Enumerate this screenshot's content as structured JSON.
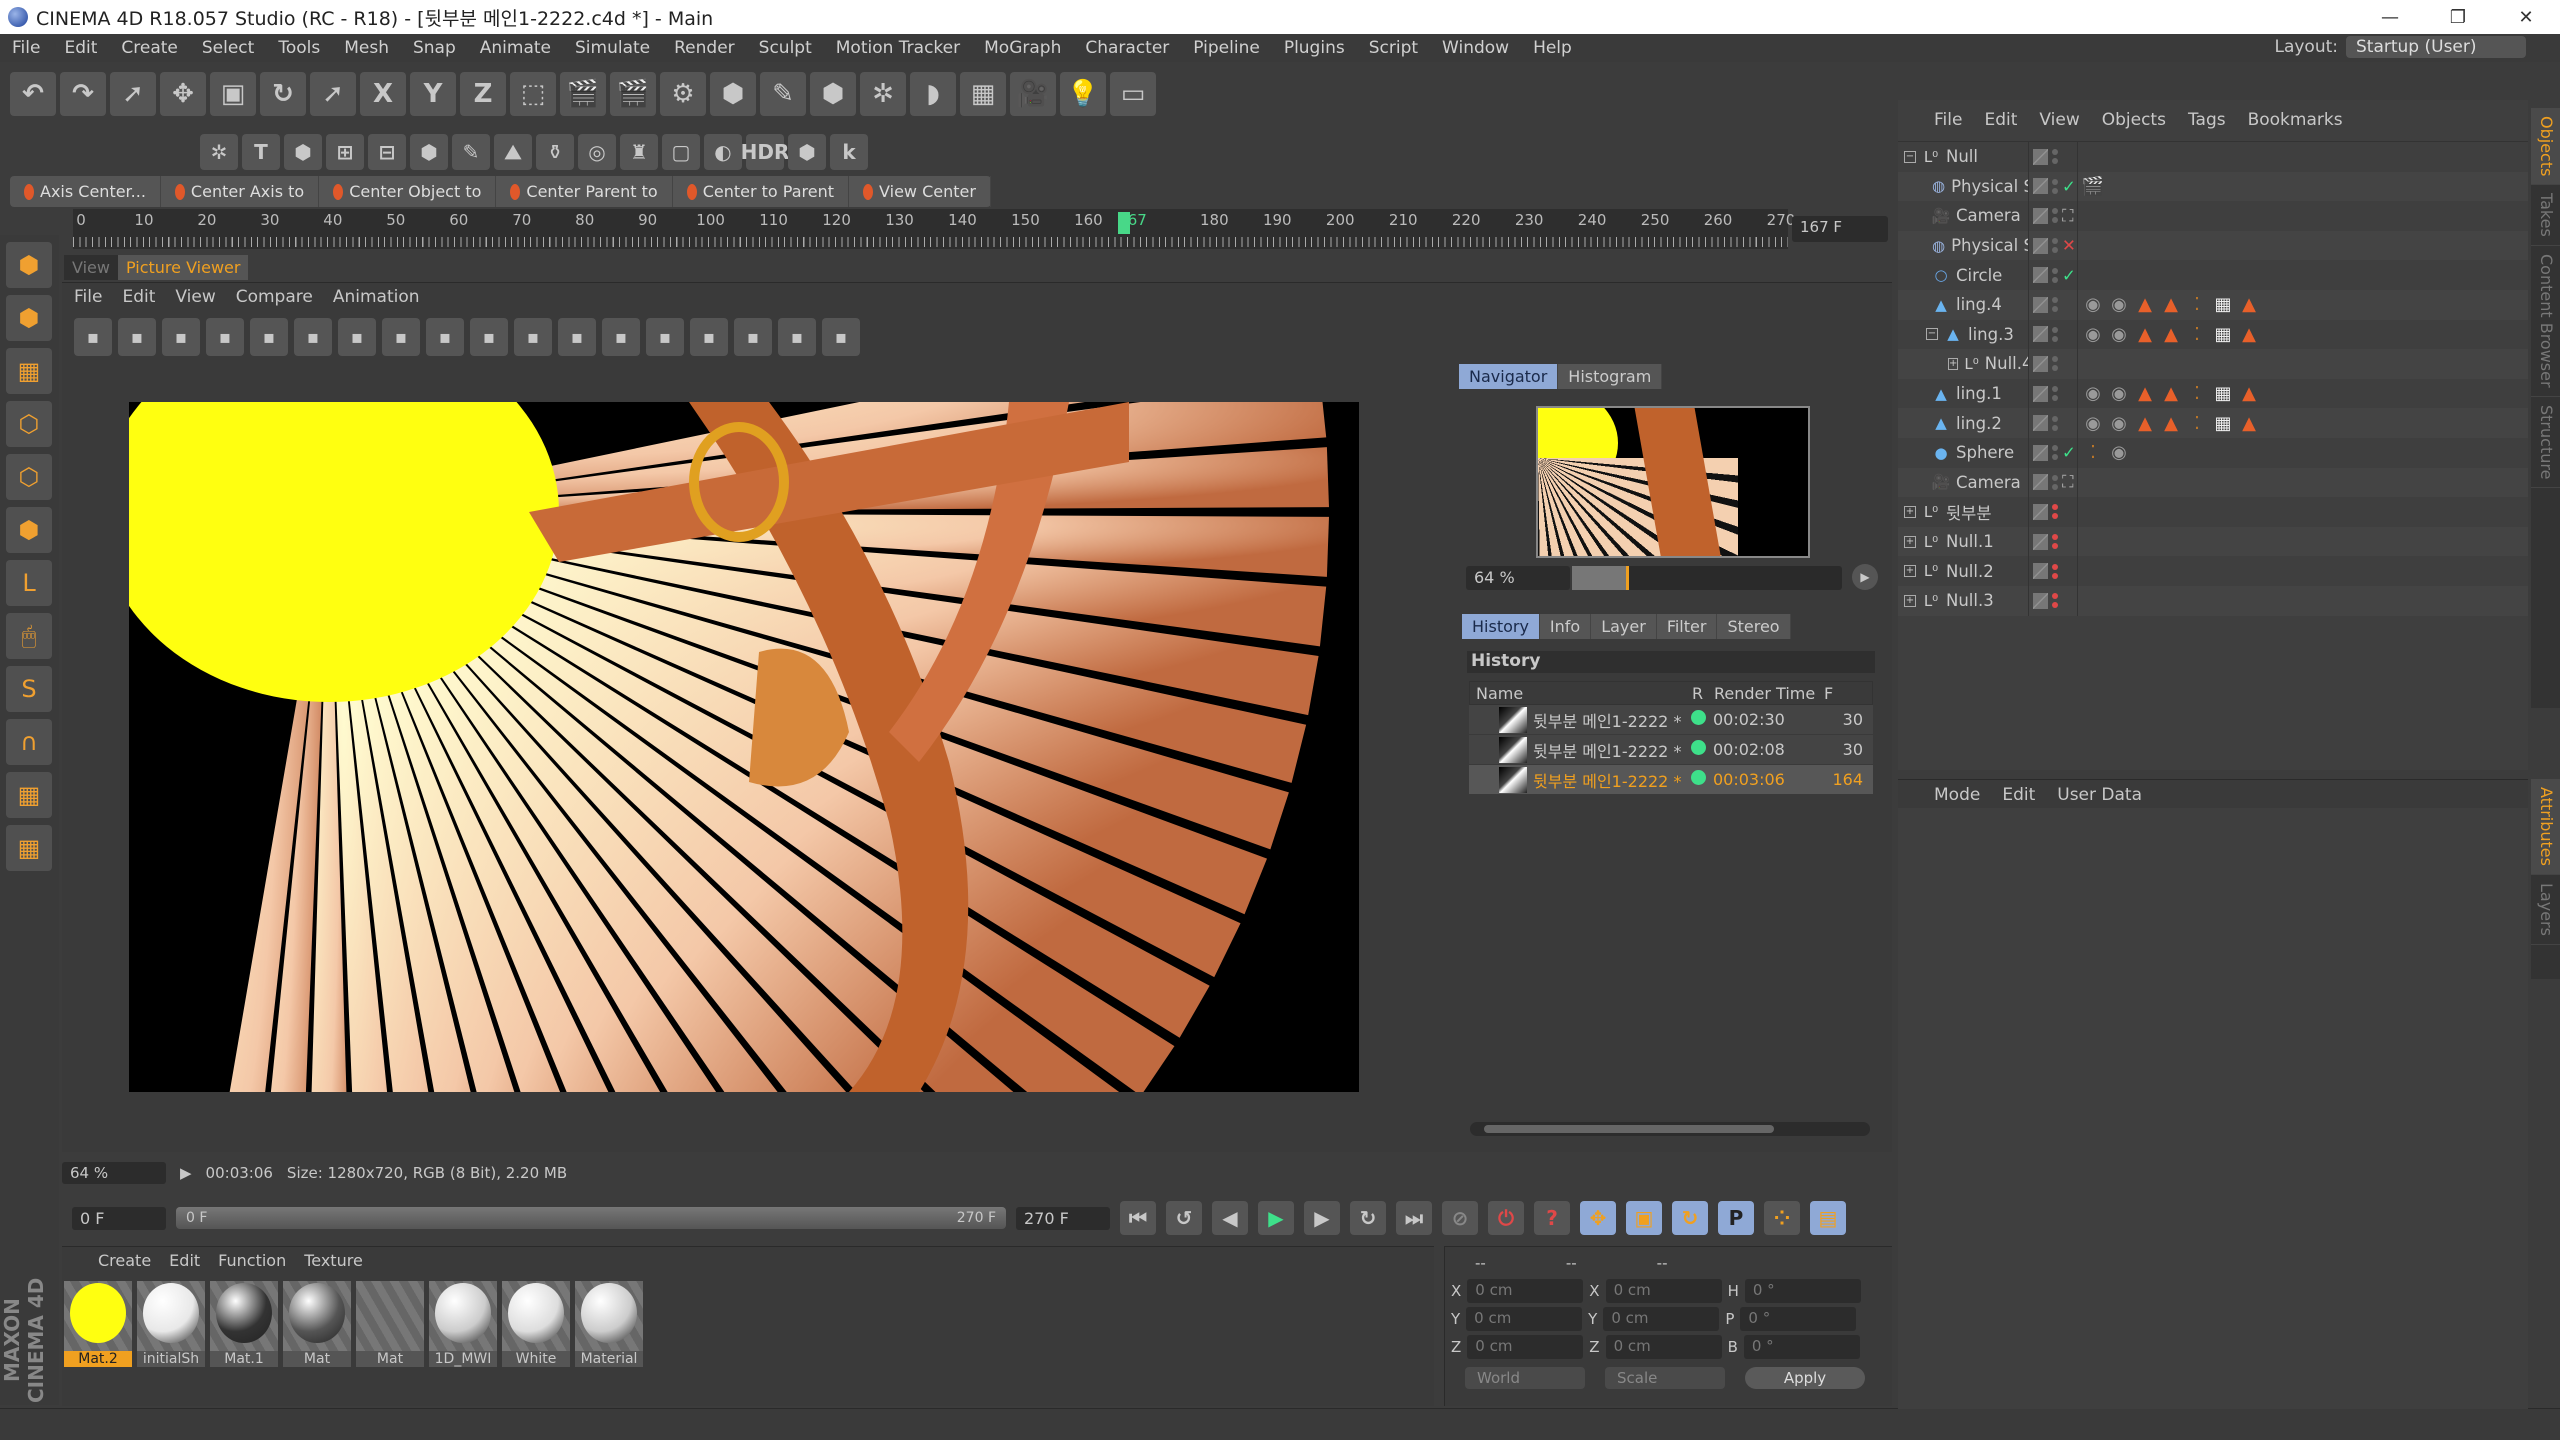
{
  "window": {
    "title": "CINEMA 4D R18.057 Studio (RC - R18) - [뒷부분 메인1-2222.c4d *] - Main",
    "controls": [
      "—",
      "❐",
      "✕"
    ]
  },
  "menu": [
    "File",
    "Edit",
    "Create",
    "Select",
    "Tools",
    "Mesh",
    "Snap",
    "Animate",
    "Simulate",
    "Render",
    "Sculpt",
    "Motion Tracker",
    "MoGraph",
    "Character",
    "Pipeline",
    "Plugins",
    "Script",
    "Window",
    "Help"
  ],
  "layout": {
    "label": "Layout:",
    "value": "Startup (User)"
  },
  "toolbar1": [
    {
      "n": "undo-icon",
      "g": "↶"
    },
    {
      "n": "redo-icon",
      "g": "↷"
    },
    {
      "n": "select-arrow-icon",
      "g": "➚"
    },
    {
      "n": "move-icon",
      "g": "✥"
    },
    {
      "n": "scale-icon",
      "g": "▣"
    },
    {
      "n": "rotate-icon",
      "g": "↻"
    },
    {
      "n": "recent-tool-icon",
      "g": "➚"
    },
    {
      "n": "x-axis-icon",
      "g": "X"
    },
    {
      "n": "y-axis-icon",
      "g": "Y"
    },
    {
      "n": "z-axis-icon",
      "g": "Z"
    },
    {
      "n": "coordinate-system-icon",
      "g": "⬚"
    },
    {
      "n": "render-view-icon",
      "g": "🎬"
    },
    {
      "n": "render-picture-viewer-icon",
      "g": "🎬"
    },
    {
      "n": "render-settings-icon",
      "g": "⚙"
    },
    {
      "n": "cube-icon",
      "g": "⬢"
    },
    {
      "n": "pen-icon",
      "g": "✎"
    },
    {
      "n": "subdivision-icon",
      "g": "⬢"
    },
    {
      "n": "cloner-icon",
      "g": "✲"
    },
    {
      "n": "deformer-icon",
      "g": "◗"
    },
    {
      "n": "floor-icon",
      "g": "▦"
    },
    {
      "n": "camera-icon",
      "g": "🎥"
    },
    {
      "n": "light-icon",
      "g": "💡"
    },
    {
      "n": "background-icon",
      "g": "▭"
    }
  ],
  "toolbar2": [
    {
      "n": "sculpt-icon",
      "g": "✲"
    },
    {
      "n": "text-icon",
      "g": "T"
    },
    {
      "n": "polygon-icon",
      "g": "⬢"
    },
    {
      "n": "snap-icon",
      "g": "⊞"
    },
    {
      "n": "workplane-icon",
      "g": "⊟"
    },
    {
      "n": "mograph-icon",
      "g": "⬢"
    },
    {
      "n": "fracture-icon",
      "g": "✎"
    },
    {
      "n": "effector-icon",
      "g": "⛰"
    },
    {
      "n": "bottle-icon",
      "g": "⚱"
    },
    {
      "n": "target-icon",
      "g": "◎"
    },
    {
      "n": "stage-icon",
      "g": "♜"
    },
    {
      "n": "sky-icon",
      "g": "▢"
    },
    {
      "n": "sphere-light-icon",
      "g": "◐"
    },
    {
      "n": "hdr-icon",
      "g": "HDR"
    },
    {
      "n": "plugin-green-icon",
      "g": "⬢"
    },
    {
      "n": "k-plugin-icon",
      "g": "k"
    }
  ],
  "commands": [
    "Axis Center...",
    "Center Axis to",
    "Center Object to",
    "Center Parent to",
    "Center to Parent",
    "View Center"
  ],
  "timeline": {
    "ticks": [
      0,
      10,
      20,
      30,
      40,
      50,
      60,
      70,
      80,
      90,
      100,
      110,
      120,
      130,
      140,
      150,
      160,
      167,
      180,
      190,
      200,
      210,
      220,
      230,
      240,
      250,
      260,
      270
    ],
    "current": 167,
    "max": 270,
    "current_label": "167 F"
  },
  "viewer": {
    "tabs": [
      "View",
      "Picture Viewer"
    ],
    "menu": [
      "File",
      "Edit",
      "View",
      "Compare",
      "Animation"
    ],
    "icons": [
      "open-icon",
      "save-icon",
      "grid-icon",
      "channels-icon",
      "stamp-icon",
      "copy-icon",
      "paste-icon",
      "region-icon",
      "region2-icon",
      "compare-icon",
      "ab-icon",
      "ab-split-icon",
      "ab-text-icon",
      "a-icon",
      "b-icon",
      "swap-icon",
      "split-icon",
      "split2-icon"
    ],
    "nav_tabs": [
      "Navigator",
      "Histogram"
    ],
    "zoom": "64 %",
    "zoom_level_pct": 20,
    "hist_tabs": [
      "History",
      "Info",
      "Layer",
      "Filter",
      "Stereo"
    ],
    "history_title": "History",
    "history_cols": [
      "Name",
      "R",
      "Render Time",
      "F"
    ],
    "history": [
      {
        "name": "뒷부분 메인1-2222 *",
        "time": "00:02:30",
        "frames": "30"
      },
      {
        "name": "뒷부분 메인1-2222 *",
        "time": "00:02:08",
        "frames": "30"
      },
      {
        "name": "뒷부분 메인1-2222 *",
        "time": "00:03:06",
        "frames": "164",
        "selected": true
      }
    ],
    "status": {
      "zoom": "64 %",
      "time": "00:03:06",
      "info": "Size: 1280x720, RGB (8 Bit), 2.20 MB"
    }
  },
  "playback": {
    "start": "0 F",
    "range_start": "0 F",
    "range_end": "270 F",
    "end": "270 F"
  },
  "materials": {
    "menu": [
      "Create",
      "Edit",
      "Function",
      "Texture"
    ],
    "items": [
      {
        "name": "Mat.2",
        "color": "#ffff10",
        "selected": true
      },
      {
        "name": "initialSh",
        "color": "#e8e8e8"
      },
      {
        "name": "Mat.1",
        "color": "#333"
      },
      {
        "name": "Mat",
        "color": "#555"
      },
      {
        "name": "Mat",
        "color": "none"
      },
      {
        "name": "1D_MWI",
        "color": "#ccc"
      },
      {
        "name": "White",
        "color": "#ddd"
      },
      {
        "name": "Material",
        "color": "#ccc"
      }
    ]
  },
  "coords": {
    "header": [
      "--",
      "--",
      "--"
    ],
    "rows": [
      [
        "X",
        "0 cm",
        "X",
        "0 cm",
        "H",
        "0 °"
      ],
      [
        "Y",
        "0 cm",
        "Y",
        "0 cm",
        "P",
        "0 °"
      ],
      [
        "Z",
        "0 cm",
        "Z",
        "0 cm",
        "B",
        "0 °"
      ]
    ],
    "mode": "World",
    "type": "Scale",
    "apply": "Apply"
  },
  "brand": "MAXON CINEMA 4D",
  "objects": {
    "menu": [
      "File",
      "Edit",
      "View",
      "Objects",
      "Tags",
      "Bookmarks"
    ],
    "items": [
      {
        "name": "Null",
        "depth": 0,
        "exp": "−",
        "icon": "null",
        "state": "",
        "red": false,
        "tags": []
      },
      {
        "name": "Physical Sky",
        "depth": 1,
        "icon": "sky",
        "state": "✓",
        "red": false,
        "tags": [
          "render-tag"
        ]
      },
      {
        "name": "Camera",
        "depth": 1,
        "icon": "camera",
        "state": "⛶",
        "red": false,
        "tags": []
      },
      {
        "name": "Physical Sky",
        "depth": 1,
        "icon": "sky",
        "state": "✕",
        "red": false,
        "tags": []
      },
      {
        "name": "Circle",
        "depth": 1,
        "icon": "circle",
        "state": "✓",
        "red": false,
        "tags": []
      },
      {
        "name": "ling.4",
        "depth": 1,
        "icon": "figure",
        "state": "",
        "red": false,
        "tags": [
          "mat",
          "mat",
          "tri",
          "tri",
          "dots",
          "check",
          "tri"
        ]
      },
      {
        "name": "ling.3",
        "depth": 1,
        "exp": "−",
        "icon": "figure",
        "state": "",
        "red": false,
        "tags": [
          "mat",
          "mat",
          "tri",
          "tri",
          "dots",
          "check",
          "tri"
        ]
      },
      {
        "name": "Null.4",
        "depth": 2,
        "exp": "+",
        "icon": "null",
        "state": "",
        "red": false,
        "tags": []
      },
      {
        "name": "ling.1",
        "depth": 1,
        "icon": "figure",
        "state": "",
        "red": false,
        "tags": [
          "mat",
          "mat",
          "tri",
          "tri",
          "dots",
          "check",
          "tri"
        ]
      },
      {
        "name": "ling.2",
        "depth": 1,
        "icon": "figure",
        "state": "",
        "red": false,
        "tags": [
          "mat",
          "mat",
          "tri",
          "tri",
          "dots",
          "check",
          "tri"
        ]
      },
      {
        "name": "Sphere",
        "depth": 1,
        "icon": "sphere",
        "state": "✓",
        "red": false,
        "tags": [
          "dots",
          "mat"
        ]
      },
      {
        "name": "Camera",
        "depth": 1,
        "icon": "camera",
        "state": "⛶",
        "red": false,
        "tags": []
      },
      {
        "name": "뒷부분",
        "depth": 0,
        "exp": "+",
        "icon": "null",
        "state": "",
        "red": true,
        "tags": []
      },
      {
        "name": "Null.1",
        "depth": 0,
        "exp": "+",
        "icon": "null",
        "state": "",
        "red": true,
        "tags": []
      },
      {
        "name": "Null.2",
        "depth": 0,
        "exp": "+",
        "icon": "null",
        "state": "",
        "red": true,
        "tags": []
      },
      {
        "name": "Null.3",
        "depth": 0,
        "exp": "+",
        "icon": "null",
        "state": "",
        "red": true,
        "tags": []
      }
    ]
  },
  "attributes": {
    "menu": [
      "Mode",
      "Edit",
      "User Data"
    ]
  },
  "side_tabs_top": [
    "Objects",
    "Takes",
    "Content Browser",
    "Structure"
  ],
  "side_tabs_bottom": [
    "Attributes",
    "Layers"
  ],
  "colors": {
    "accent": "#f0a020",
    "tab_active": "#8fa9d6",
    "ok_green": "#3ee08a",
    "tag_orange": "#e8602a"
  }
}
